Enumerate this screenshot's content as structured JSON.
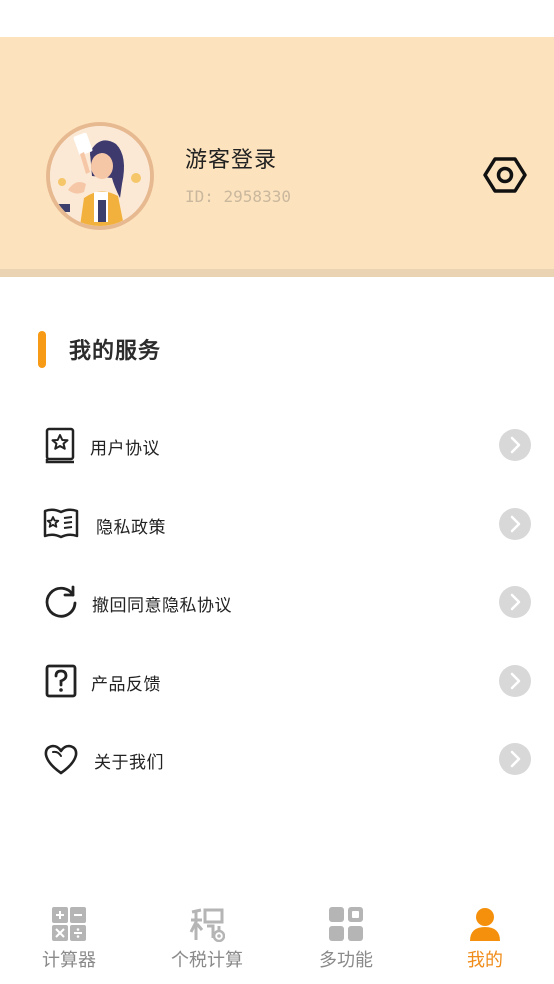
{
  "profile": {
    "username": "游客登录",
    "user_id": "ID: 2958330"
  },
  "services": {
    "title": "我的服务",
    "items": [
      {
        "label": "用户协议",
        "icon": "book-star-icon"
      },
      {
        "label": "隐私政策",
        "icon": "privacy-book-icon"
      },
      {
        "label": "撤回同意隐私协议",
        "icon": "refresh-icon"
      },
      {
        "label": "产品反馈",
        "icon": "question-icon"
      },
      {
        "label": "关于我们",
        "icon": "heart-icon"
      }
    ]
  },
  "tabs": [
    {
      "label": "计算器",
      "icon": "calculator-icon",
      "active": false
    },
    {
      "label": "个税计算",
      "icon": "tax-icon",
      "active": false
    },
    {
      "label": "多功能",
      "icon": "grid-icon",
      "active": false
    },
    {
      "label": "我的",
      "icon": "person-icon",
      "active": true
    }
  ],
  "colors": {
    "header_bg": "#fde3bd",
    "accent": "#f79a16",
    "active_tab": "#f08c1a",
    "inactive_tab": "#8a8a8a",
    "arrow_bg": "#d8d8d8"
  }
}
